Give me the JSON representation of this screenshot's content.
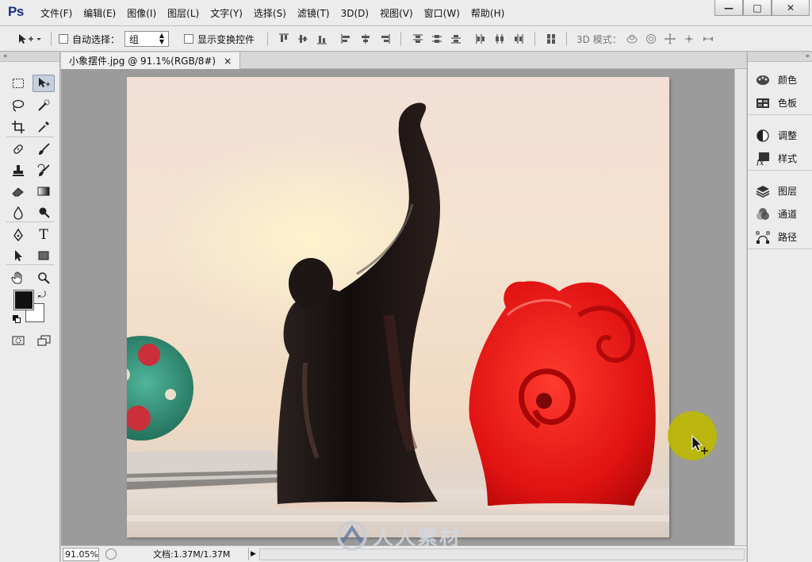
{
  "app": {
    "logo": "Ps",
    "menu": [
      "文件(F)",
      "编辑(E)",
      "图像(I)",
      "图层(L)",
      "文字(Y)",
      "选择(S)",
      "滤镜(T)",
      "3D(D)",
      "视图(V)",
      "窗口(W)",
      "帮助(H)"
    ],
    "window_controls": [
      "—",
      "□",
      "✕"
    ]
  },
  "options": {
    "auto_select_label": "自动选择：",
    "auto_select_value": "组",
    "show_transform_label": "显示变换控件",
    "mode_3d_label": "3D 模式："
  },
  "document": {
    "tab_title": "小象摆件.jpg @ 91.1%(RGB/8#)",
    "tab_close": "×",
    "zoom": "91.05%",
    "doc_info": "文档:1.37M/1.37M",
    "status_arrow": "▶"
  },
  "toolbar": {
    "collapse": "«",
    "tools": [
      "rect-marquee",
      "move",
      "lasso",
      "quick-select",
      "crop",
      "eyedropper",
      "spot-heal",
      "brush",
      "clone-stamp",
      "history-brush",
      "eraser",
      "gradient",
      "blur",
      "dodge",
      "pen",
      "type",
      "path-select",
      "rectangle",
      "hand",
      "zoom"
    ],
    "type_glyph": "T",
    "foreground_color": "#111111",
    "background_color": "#ffffff"
  },
  "right_panel": {
    "collapse": "»",
    "groups": [
      [
        {
          "icon": "palette-icon",
          "label": "颜色"
        },
        {
          "icon": "swatches-icon",
          "label": "色板"
        }
      ],
      [
        {
          "icon": "adjustments-icon",
          "label": "调整"
        },
        {
          "icon": "styles-icon",
          "label": "样式"
        }
      ],
      [
        {
          "icon": "layers-icon",
          "label": "图层"
        },
        {
          "icon": "channels-icon",
          "label": "通道"
        },
        {
          "icon": "paths-icon",
          "label": "路径"
        }
      ]
    ]
  },
  "watermark": "人人素材",
  "colors": {
    "accent_logo": "#1c2f86",
    "elephant_dark": "#1b1514",
    "elephant_red": "#e01212",
    "cursor_highlight": "#bebd00"
  }
}
